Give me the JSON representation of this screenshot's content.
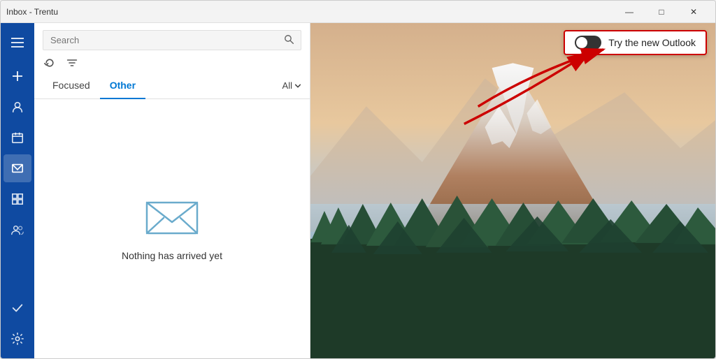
{
  "window": {
    "title": "Inbox - Trentu",
    "controls": {
      "minimize": "—",
      "maximize": "□",
      "close": "✕"
    }
  },
  "nav": {
    "icons": [
      {
        "name": "hamburger-menu",
        "symbol": "☰"
      },
      {
        "name": "add-new",
        "symbol": "+"
      },
      {
        "name": "people",
        "symbol": "👤"
      },
      {
        "name": "calendar",
        "symbol": "☐"
      },
      {
        "name": "mail",
        "symbol": "✉"
      },
      {
        "name": "calendar2",
        "symbol": "▦"
      },
      {
        "name": "contacts2",
        "symbol": "👥"
      },
      {
        "name": "tasks",
        "symbol": "✓"
      },
      {
        "name": "settings",
        "symbol": "⚙"
      }
    ]
  },
  "mail_panel": {
    "search": {
      "placeholder": "Search",
      "value": ""
    },
    "tabs": [
      {
        "label": "Focused",
        "active": false
      },
      {
        "label": "Other",
        "active": true
      }
    ],
    "filter_label": "All",
    "empty_state": {
      "message": "Nothing has arrived yet"
    }
  },
  "outlook_toggle": {
    "label": "Try the new Outlook",
    "checked": false
  }
}
